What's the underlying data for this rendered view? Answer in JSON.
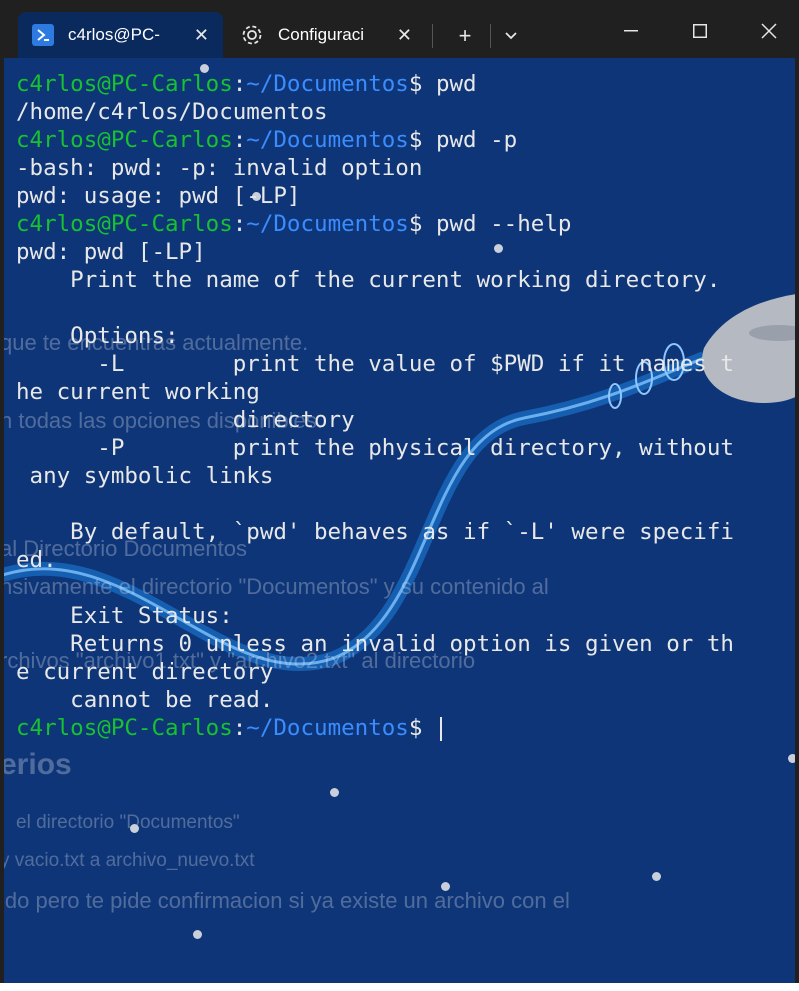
{
  "tabs": [
    {
      "label": "c4rlos@PC-",
      "icon": "powershell-icon",
      "active": true
    },
    {
      "label": "Configuraci",
      "icon": "gear-icon",
      "active": false
    }
  ],
  "toolbar": {
    "new_tab": "+",
    "dropdown": "⌄"
  },
  "window_controls": {
    "minimize": "—",
    "maximize": "☐",
    "close": "✕"
  },
  "terminal": {
    "prompt_user": "c4rlos@PC-Carlos",
    "prompt_path": "~/Documentos",
    "lines": [
      {
        "type": "prompt",
        "cmd": "pwd"
      },
      {
        "type": "out",
        "text": "/home/c4rlos/Documentos"
      },
      {
        "type": "prompt",
        "cmd": "pwd -p"
      },
      {
        "type": "out",
        "text": "-bash: pwd: -p: invalid option"
      },
      {
        "type": "out",
        "text": "pwd: usage: pwd [-LP]"
      },
      {
        "type": "prompt",
        "cmd": "pwd --help"
      },
      {
        "type": "out",
        "text": "pwd: pwd [-LP]"
      },
      {
        "type": "out",
        "text": "    Print the name of the current working directory."
      },
      {
        "type": "out",
        "text": ""
      },
      {
        "type": "out",
        "text": "    Options:"
      },
      {
        "type": "out",
        "text": "      -L        print the value of $PWD if it names t"
      },
      {
        "type": "out",
        "text": "he current working"
      },
      {
        "type": "out",
        "text": "                directory"
      },
      {
        "type": "out",
        "text": "      -P        print the physical directory, without"
      },
      {
        "type": "out",
        "text": " any symbolic links"
      },
      {
        "type": "out",
        "text": ""
      },
      {
        "type": "out",
        "text": "    By default, `pwd' behaves as if `-L' were specifi"
      },
      {
        "type": "out",
        "text": "ed."
      },
      {
        "type": "out",
        "text": ""
      },
      {
        "type": "out",
        "text": "    Exit Status:"
      },
      {
        "type": "out",
        "text": "    Returns 0 unless an invalid option is given or th"
      },
      {
        "type": "out",
        "text": "e current directory"
      },
      {
        "type": "out",
        "text": "    cannot be read."
      },
      {
        "type": "prompt",
        "cmd": ""
      }
    ]
  },
  "background_ghost_text": [
    "que te encuentras actualmente.",
    "n todas las opciones disponibles.",
    "al Directorio Documentos",
    "nsivamente el directorio \"Documentos\" y su contenido al",
    "rchivos \"archivo1.txt\" y \"archivo2.txt\" al directorio",
    "erios",
    "el directorio \"Documentos\"",
    "y vacio.txt  a  archivo_nuevo.txt",
    "ido pero te pide confirmacion si ya existe un archivo con el"
  ],
  "colors": {
    "terminal_bg": "#0e3577",
    "user": "#17c12f",
    "path": "#3a8cff",
    "text": "#e8e8e8"
  }
}
